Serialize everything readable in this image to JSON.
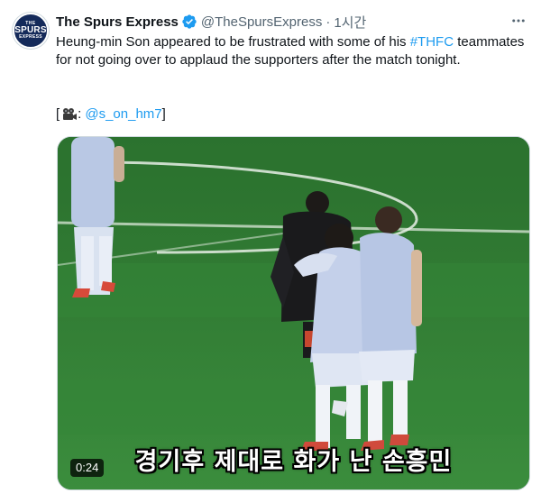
{
  "author": {
    "display_name": "The Spurs Express",
    "handle": "@TheSpursExpress",
    "separator": "·",
    "time": "1시간",
    "avatar_text": [
      "THE",
      "SPURS",
      "EXPRESS"
    ],
    "verified": true,
    "verified_color": "#1d9bf0"
  },
  "tweet": {
    "text_before": "Heung-min Son appeared to be frustrated with some of his ",
    "hashtag": "#THFC",
    "text_after": " teammates for not going over to applaud the supporters after the match tonight.",
    "credit_open": "[",
    "credit_icon": "movie-camera-icon",
    "credit_colon": ":",
    "mention": "@s_on_hm7",
    "credit_close": "]"
  },
  "media": {
    "type": "video",
    "duration": "0:24",
    "subtitle": "경기후 제대로 화가 난 손흥민"
  },
  "icons": {
    "more": "more-horizontal-icon",
    "verified": "verified-badge-icon"
  },
  "colors": {
    "text_primary": "#0f1419",
    "text_secondary": "#536471",
    "link": "#1d9bf0",
    "pitch": "#2f7d33"
  }
}
